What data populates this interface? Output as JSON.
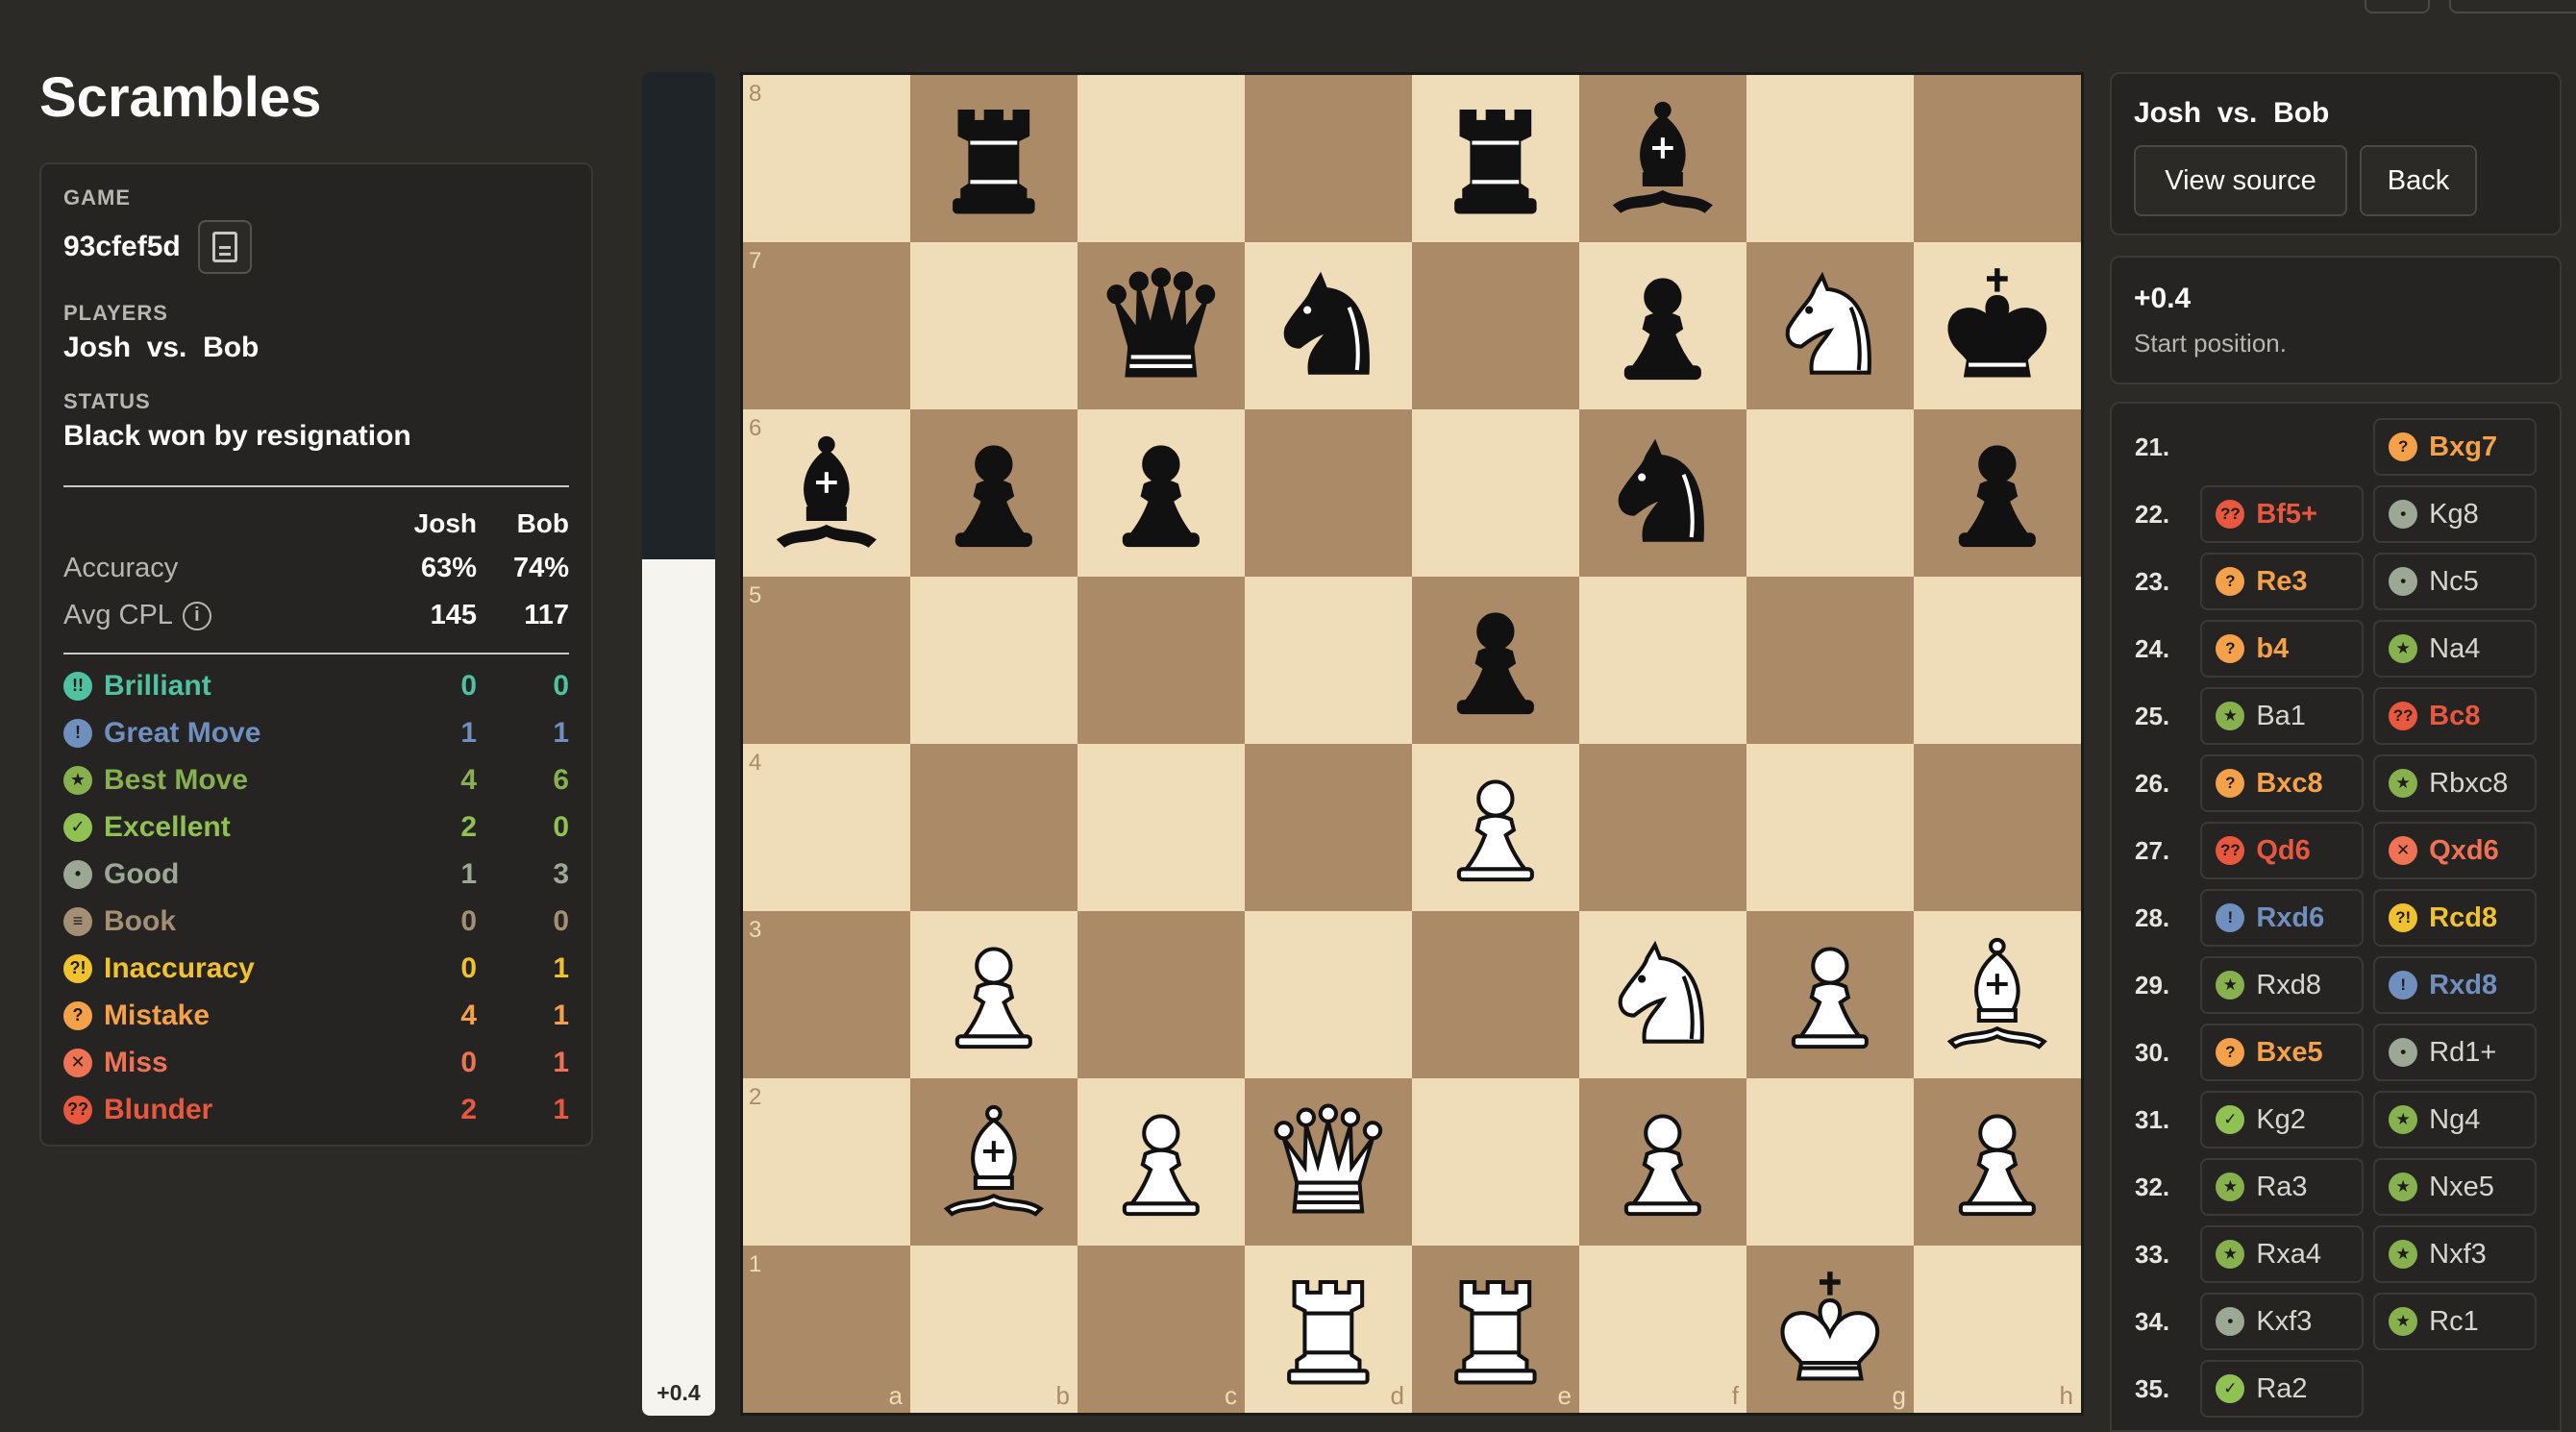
{
  "app": {
    "title": "Scrambles"
  },
  "game": {
    "label": "GAME",
    "id": "93cfef5d",
    "players_label": "PLAYERS",
    "players": "Josh  vs.  Bob",
    "status_label": "STATUS",
    "status": "Black won by resignation"
  },
  "stats": {
    "headers": [
      "Josh",
      "Bob"
    ],
    "rows": [
      {
        "name": "Accuracy",
        "white": "63%",
        "black": "74%"
      },
      {
        "name": "Avg CPL",
        "white": "145",
        "black": "117",
        "info": true
      }
    ]
  },
  "classifications": [
    {
      "name": "Brilliant",
      "icon": "!!",
      "color": "#4fc3a1",
      "white": "0",
      "black": "0"
    },
    {
      "name": "Great Move",
      "icon": "!",
      "color": "#6f8fbf",
      "white": "1",
      "black": "1"
    },
    {
      "name": "Best Move",
      "icon": "★",
      "color": "#87b04e",
      "white": "4",
      "black": "6"
    },
    {
      "name": "Excellent",
      "icon": "✓",
      "color": "#8fc253",
      "white": "2",
      "black": "0"
    },
    {
      "name": "Good",
      "icon": "•",
      "color": "#9aa894",
      "white": "1",
      "black": "3"
    },
    {
      "name": "Book",
      "icon": "≡",
      "color": "#a38f74",
      "white": "0",
      "black": "0"
    },
    {
      "name": "Inaccuracy",
      "icon": "?!",
      "color": "#f0c230",
      "white": "0",
      "black": "1"
    },
    {
      "name": "Mistake",
      "icon": "?",
      "color": "#f5a14a",
      "white": "4",
      "black": "1"
    },
    {
      "name": "Miss",
      "icon": "✕",
      "color": "#ee7355",
      "white": "0",
      "black": "1"
    },
    {
      "name": "Blunder",
      "icon": "??",
      "color": "#e8583e",
      "white": "2",
      "black": "1"
    }
  ],
  "evaluation": {
    "label": "+0.4",
    "white_fraction": 0.637
  },
  "board": {
    "files": [
      "a",
      "b",
      "c",
      "d",
      "e",
      "f",
      "g",
      "h"
    ],
    "ranks": [
      "8",
      "7",
      "6",
      "5",
      "4",
      "3",
      "2",
      "1"
    ],
    "position": [
      [
        "",
        "bR",
        "",
        "",
        "bR",
        "bB",
        "",
        ""
      ],
      [
        "",
        "",
        "bQ",
        "bN",
        "",
        "bP",
        "wN",
        "bK"
      ],
      [
        "bB",
        "bP",
        "bP",
        "",
        "",
        "bN",
        "",
        "bP"
      ],
      [
        "",
        "",
        "",
        "",
        "bP",
        "",
        "",
        ""
      ],
      [
        "",
        "",
        "",
        "",
        "wP",
        "",
        "",
        ""
      ],
      [
        "",
        "wP",
        "",
        "",
        "",
        "wN",
        "wP",
        "wB"
      ],
      [
        "",
        "wB",
        "wP",
        "wQ",
        "",
        "wP",
        "",
        "wP"
      ],
      [
        "",
        "",
        "",
        "wR",
        "wR",
        "",
        "wK",
        ""
      ]
    ]
  },
  "header_panel": {
    "title": "Josh  vs.  Bob",
    "view_source": "View source",
    "back": "Back"
  },
  "eval_panel": {
    "value": "+0.4",
    "description": "Start position."
  },
  "moves": [
    {
      "num": "21.",
      "white": null,
      "black": {
        "san": "Bxg7",
        "cls": "Mistake"
      }
    },
    {
      "num": "22.",
      "white": {
        "san": "Bf5+",
        "cls": "Blunder"
      },
      "black": {
        "san": "Kg8",
        "cls": "Good"
      }
    },
    {
      "num": "23.",
      "white": {
        "san": "Re3",
        "cls": "Mistake"
      },
      "black": {
        "san": "Nc5",
        "cls": "Good"
      }
    },
    {
      "num": "24.",
      "white": {
        "san": "b4",
        "cls": "Mistake"
      },
      "black": {
        "san": "Na4",
        "cls": "Best Move"
      }
    },
    {
      "num": "25.",
      "white": {
        "san": "Ba1",
        "cls": "Best Move"
      },
      "black": {
        "san": "Bc8",
        "cls": "Blunder"
      }
    },
    {
      "num": "26.",
      "white": {
        "san": "Bxc8",
        "cls": "Mistake"
      },
      "black": {
        "san": "Rbxc8",
        "cls": "Best Move"
      }
    },
    {
      "num": "27.",
      "white": {
        "san": "Qd6",
        "cls": "Blunder"
      },
      "black": {
        "san": "Qxd6",
        "cls": "Miss"
      }
    },
    {
      "num": "28.",
      "white": {
        "san": "Rxd6",
        "cls": "Great Move"
      },
      "black": {
        "san": "Rcd8",
        "cls": "Inaccuracy"
      }
    },
    {
      "num": "29.",
      "white": {
        "san": "Rxd8",
        "cls": "Best Move"
      },
      "black": {
        "san": "Rxd8",
        "cls": "Great Move"
      }
    },
    {
      "num": "30.",
      "white": {
        "san": "Bxe5",
        "cls": "Mistake"
      },
      "black": {
        "san": "Rd1+",
        "cls": "Good"
      }
    },
    {
      "num": "31.",
      "white": {
        "san": "Kg2",
        "cls": "Excellent"
      },
      "black": {
        "san": "Ng4",
        "cls": "Best Move"
      }
    },
    {
      "num": "32.",
      "white": {
        "san": "Ra3",
        "cls": "Best Move"
      },
      "black": {
        "san": "Nxe5",
        "cls": "Best Move"
      }
    },
    {
      "num": "33.",
      "white": {
        "san": "Rxa4",
        "cls": "Best Move"
      },
      "black": {
        "san": "Nxf3",
        "cls": "Best Move"
      }
    },
    {
      "num": "34.",
      "white": {
        "san": "Kxf3",
        "cls": "Good"
      },
      "black": {
        "san": "Rc1",
        "cls": "Best Move"
      }
    },
    {
      "num": "35.",
      "white": {
        "san": "Ra2",
        "cls": "Excellent"
      },
      "black": null
    }
  ]
}
